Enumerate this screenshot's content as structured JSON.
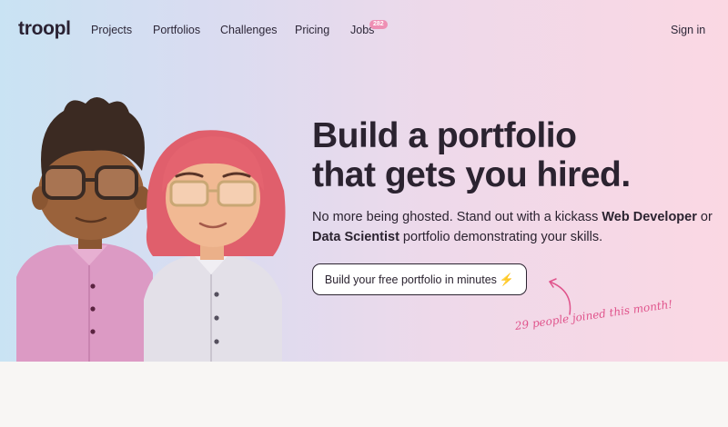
{
  "nav": {
    "logo": "troopl",
    "links": [
      "Projects",
      "Portfolios",
      "Challenges",
      "Pricing",
      "Jobs"
    ],
    "jobs_badge": "282",
    "signin": "Sign in"
  },
  "hero": {
    "headline_line1": "Build a portfolio",
    "headline_line2": "that gets you hired.",
    "sub_part1": "No more being ghosted. Stand out with a kickass ",
    "sub_bold1": "Web Developer",
    "sub_part2": " or ",
    "sub_bold2": "Data Scientist",
    "sub_part3": " portfolio demonstrating your skills.",
    "cta_label": "Build your free portfolio in minutes",
    "cta_icon": "⚡",
    "joined_note": "29 people joined this month!"
  },
  "colors": {
    "text": "#2b2330",
    "badge": "#ee8fb4",
    "accent_handwriting": "#e0548c",
    "gradient_left": "#c9e3f3",
    "gradient_right": "#fbd8e3"
  },
  "icons": {
    "illustration": "two-avatars-illustration",
    "arrow": "curved-arrow-icon",
    "bolt": "lightning-bolt-icon"
  }
}
